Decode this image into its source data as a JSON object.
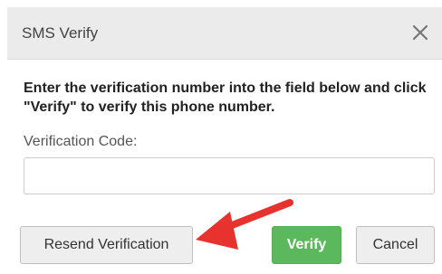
{
  "dialog": {
    "title": "SMS Verify",
    "close_icon": "close-icon"
  },
  "body": {
    "instructions": "Enter the verification number into the field below and click \"Verify\" to verify this phone number.",
    "code_label": "Verification Code:",
    "code_value": "",
    "code_placeholder": ""
  },
  "buttons": {
    "resend": "Resend Verification",
    "verify": "Verify",
    "cancel": "Cancel"
  },
  "annotation": {
    "arrow_icon": "red-arrow-icon",
    "arrow_color": "#e8322d"
  },
  "colors": {
    "verify_button": "#5cb85c",
    "header_background": "#ebebeb"
  }
}
